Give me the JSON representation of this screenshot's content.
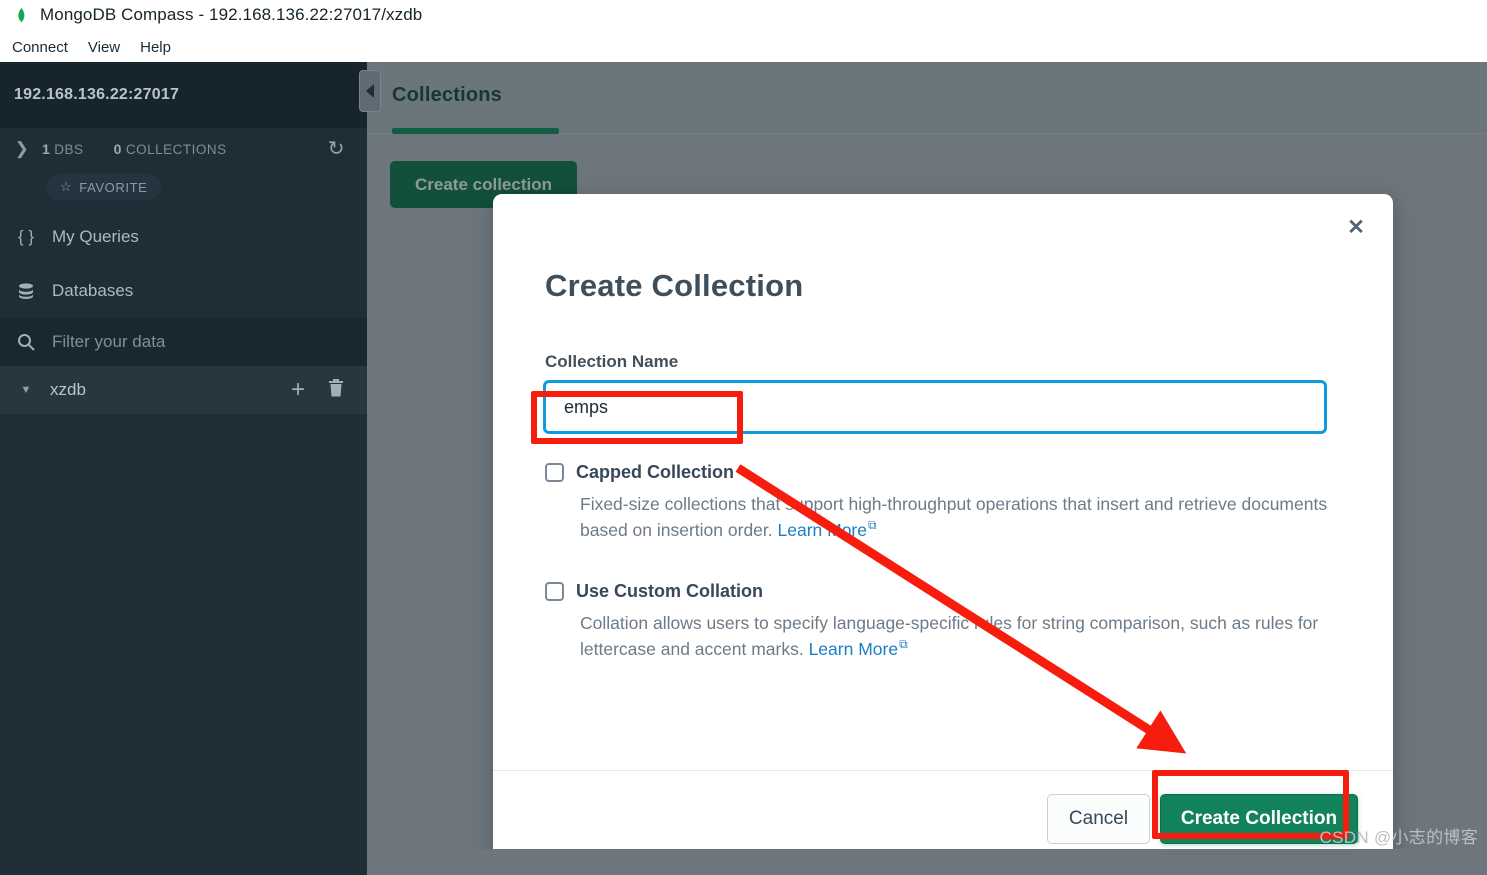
{
  "window": {
    "title": "MongoDB Compass - 192.168.136.22:27017/xzdb",
    "leaf_icon": "mongodb-leaf-icon"
  },
  "menubar": {
    "items": [
      {
        "label": "Connect",
        "name": "menu-connect"
      },
      {
        "label": "View",
        "name": "menu-view"
      },
      {
        "label": "Help",
        "name": "menu-help"
      }
    ]
  },
  "sidebar": {
    "connection_host": "192.168.136.22:27017",
    "stats": {
      "dbs_count": "1",
      "dbs_label": "DBS",
      "collections_count": "0",
      "collections_label": "COLLECTIONS",
      "refresh_icon": "refresh-icon",
      "expand_icon": "chevron-right-icon"
    },
    "favorite_chip": {
      "label": "FAVORITE",
      "icon": "star-icon"
    },
    "nav_items": [
      {
        "label": "My Queries",
        "icon": "braces-icon",
        "name": "sidebar-item-my-queries"
      },
      {
        "label": "Databases",
        "icon": "database-icon",
        "name": "sidebar-item-databases"
      }
    ],
    "filter": {
      "placeholder": "Filter your data",
      "value": "",
      "icon": "search-icon"
    },
    "database": {
      "name": "xzdb",
      "caret_icon": "caret-down-icon",
      "add_icon": "plus-icon",
      "delete_icon": "trash-icon"
    }
  },
  "content": {
    "tab_label": "Collections",
    "create_collection_button": "Create collection",
    "collapse_icon": "chevron-left-icon"
  },
  "modal": {
    "title": "Create Collection",
    "close_icon": "close-icon",
    "field_label": "Collection Name",
    "field_value": "emps",
    "field_placeholder": "",
    "options": [
      {
        "title": "Capped Collection",
        "description": "Fixed-size collections that support high-throughput operations that insert and retrieve documents based on insertion order. ",
        "link_label": "Learn More",
        "link_icon": "external-link-icon",
        "checked": false
      },
      {
        "title": "Use Custom Collation",
        "description": "Collation allows users to specify language-specific rules for string comparison, such as rules for lettercase and accent marks. ",
        "link_label": "Learn More",
        "link_icon": "external-link-icon",
        "checked": false
      }
    ],
    "cancel_label": "Cancel",
    "submit_label": "Create Collection"
  },
  "annotations": {
    "color": "#f61d0f",
    "arrow_from": "Capped Collection label area",
    "arrow_to": "Create Collection button",
    "highlight_input": true,
    "highlight_submit": true
  },
  "watermark": "CSDN @小志的博客",
  "colors": {
    "accent_green": "#11825a",
    "tab_underline": "#125c43",
    "focus_blue": "#0f9bde",
    "link_blue": "#1a7fc4",
    "sidebar_bg": "#1f2d36",
    "sidebar_header_bg": "#15242d",
    "overlay_bg": "#6d767d",
    "annotation_red": "#f61d0f"
  }
}
